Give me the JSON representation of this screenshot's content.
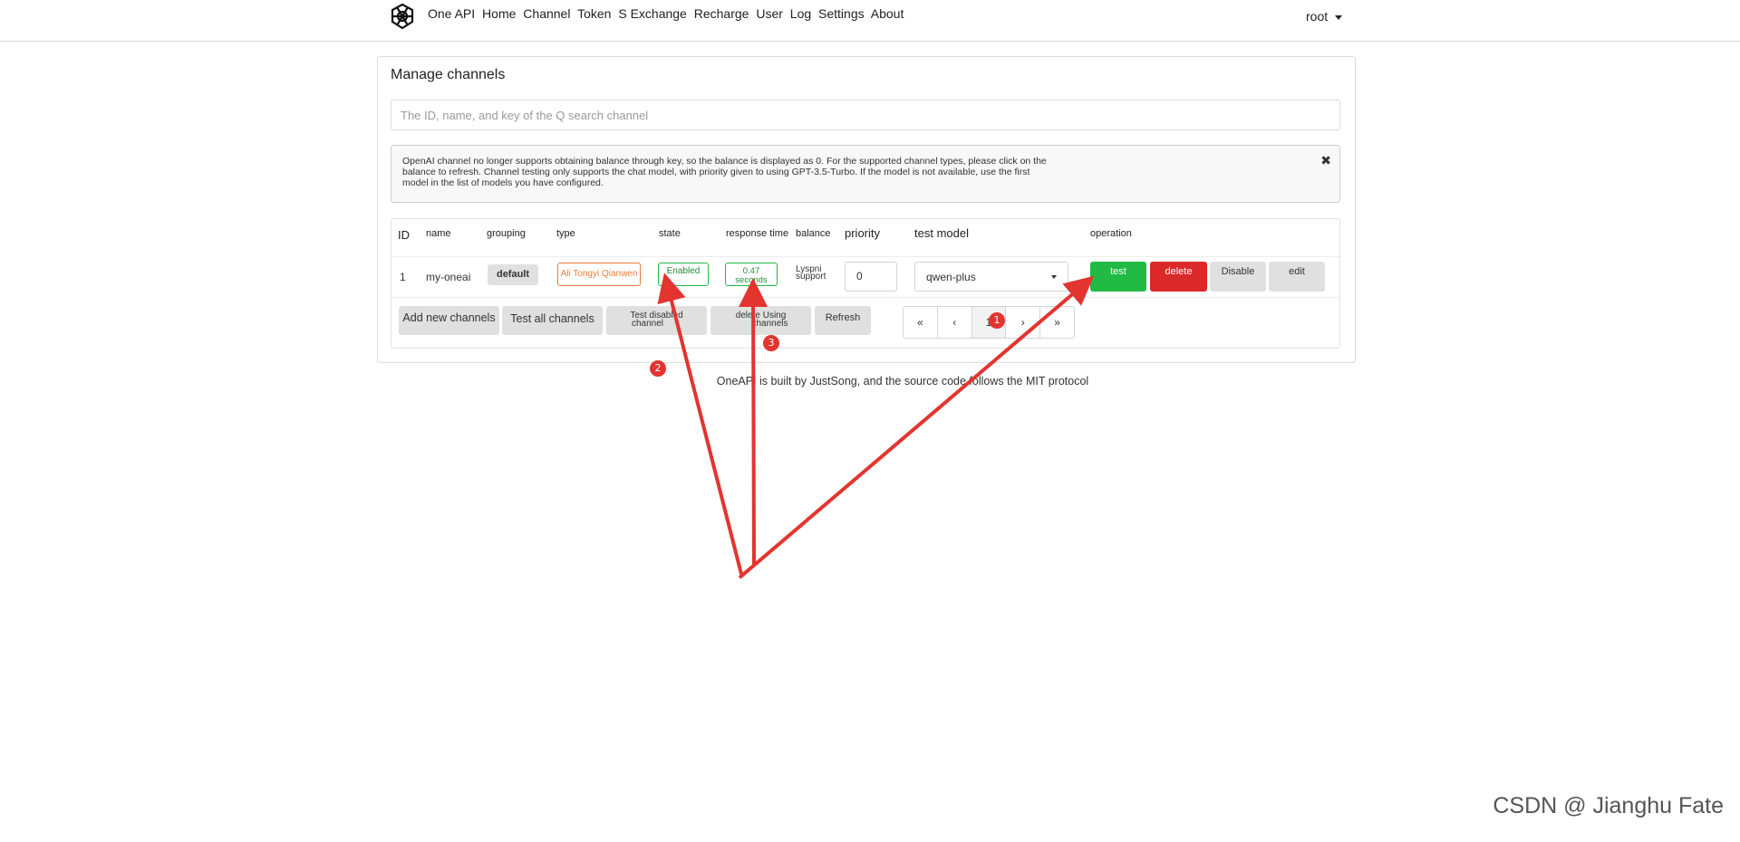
{
  "nav": {
    "links": [
      "One API",
      "Home",
      "Channel",
      "Token",
      "S Exchange",
      "Recharge",
      "User",
      "Log",
      "Settings",
      "About"
    ],
    "user": "root"
  },
  "page": {
    "title": "Manage channels",
    "search_placeholder": "The ID, name, and key of the Q search channel",
    "notice": "OpenAI channel no longer supports obtaining balance through key, so the balance is displayed as 0. For the supported channel types, please click on the balance to refresh. Channel testing only supports the chat model, with priority given to using GPT-3.5-Turbo. If the model is not available, use the first model in the list of models you have configured.",
    "close_icon": "✖"
  },
  "table": {
    "headers": {
      "id": "ID",
      "name": "name",
      "grouping": "grouping",
      "type": "type",
      "state": "state",
      "response_time": "response time",
      "balance": "balance",
      "priority": "priority",
      "test_model": "test model",
      "operation": "operation"
    },
    "row": {
      "id": "1",
      "name": "my-oneai",
      "group": "default",
      "type": "Ali Tongyi Qianwen",
      "state": "Enabled",
      "response_value": "0.47",
      "response_unit": "seconds",
      "balance_line1": "Lyspni",
      "balance_line2": "support",
      "priority": "0",
      "model": "qwen-plus",
      "test_label": "test",
      "delete_label": "delete",
      "disable_label": "Disable",
      "edit_label": "edit"
    },
    "actions": {
      "add": "Add new channels",
      "test_all": "Test all channels",
      "test_disabled_1": "Test disabled",
      "test_disabled_2": "channel",
      "delete_using_1": "delete",
      "delete_using_2": "Using",
      "delete_using_3": "channels",
      "refresh": "Refresh"
    },
    "pager": {
      "first": "«",
      "prev": "‹",
      "current": "1",
      "next": "›",
      "last": "»"
    }
  },
  "footer": "OneAPI is built by JustSong, and the source code follows the MIT protocol",
  "watermark": "CSDN @ Jianghu Fate",
  "annotations": {
    "badge1": "1",
    "badge2": "2",
    "badge3": "3",
    "arrow_color": "#e3342f"
  },
  "colors": {
    "green": "#21ba45",
    "red": "#db2828",
    "orange_tag": "#e87e3c"
  }
}
